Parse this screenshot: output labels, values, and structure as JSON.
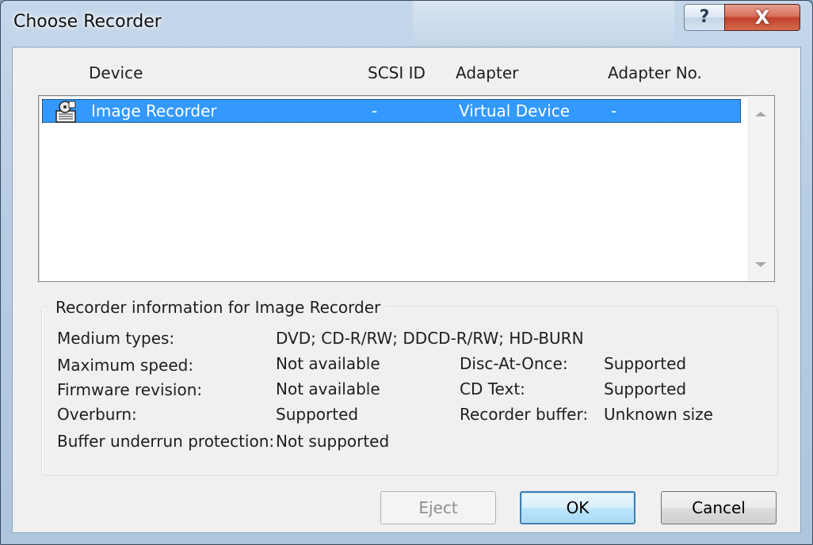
{
  "window": {
    "title": "Choose Recorder",
    "help_label": "?",
    "close_label": "X"
  },
  "columns": {
    "device": "Device",
    "scsi_id": "SCSI ID",
    "adapter": "Adapter",
    "adapter_no": "Adapter No."
  },
  "recorders": [
    {
      "device": "Image Recorder",
      "scsi_id": "-",
      "adapter": "Virtual Device",
      "adapter_no": "-",
      "icon": "image-recorder-icon",
      "selected": true
    }
  ],
  "info": {
    "title": "Recorder information for Image Recorder",
    "medium_types_label": "Medium types:",
    "medium_types_value": "DVD; CD-R/RW; DDCD-R/RW; HD-BURN",
    "max_speed_label": "Maximum speed:",
    "max_speed_value": "Not available",
    "firmware_label": "Firmware revision:",
    "firmware_value": "Not available",
    "overburn_label": "Overburn:",
    "overburn_value": "Supported",
    "buffer_underrun_label": "Buffer underrun protection:",
    "buffer_underrun_value": "Not supported",
    "dao_label": "Disc-At-Once:",
    "dao_value": "Supported",
    "cdtext_label": "CD Text:",
    "cdtext_value": "Supported",
    "recorder_buffer_label": "Recorder buffer:",
    "recorder_buffer_value": "Unknown size"
  },
  "buttons": {
    "eject": "Eject",
    "ok": "OK",
    "cancel": "Cancel"
  }
}
